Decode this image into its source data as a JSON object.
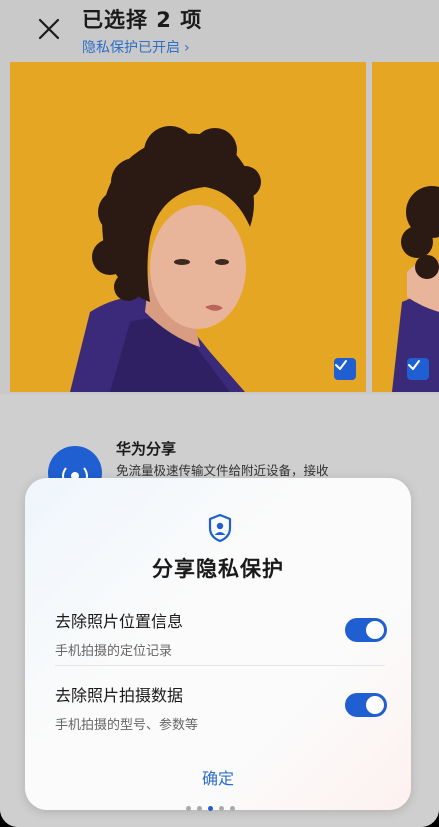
{
  "header": {
    "title": "已选择 2 项",
    "privacy_link": "隐私保护已开启",
    "privacy_chevron": "›"
  },
  "photos": [
    {
      "name": "portrait-photo-1",
      "selected": true
    },
    {
      "name": "portrait-photo-2",
      "selected": true
    }
  ],
  "share": {
    "title": "华为分享",
    "description": "免流量极速传输文件给附近设备，接收"
  },
  "dialog": {
    "title": "分享隐私保护",
    "options": [
      {
        "title": "去除照片位置信息",
        "subtitle": "手机拍摄的定位记录",
        "enabled": true
      },
      {
        "title": "去除照片拍摄数据",
        "subtitle": "手机拍摄的型号、参数等",
        "enabled": true
      }
    ],
    "confirm_label": "确定"
  },
  "icons": {
    "close": "close-icon",
    "check": "checkmark-icon",
    "shield": "shield-user-icon",
    "share": "huawei-share-icon"
  },
  "colors": {
    "accent": "#1f5fd1",
    "link": "#2f6fc8",
    "photo_background": "#e5a623",
    "jacket": "#3b2a7a"
  }
}
